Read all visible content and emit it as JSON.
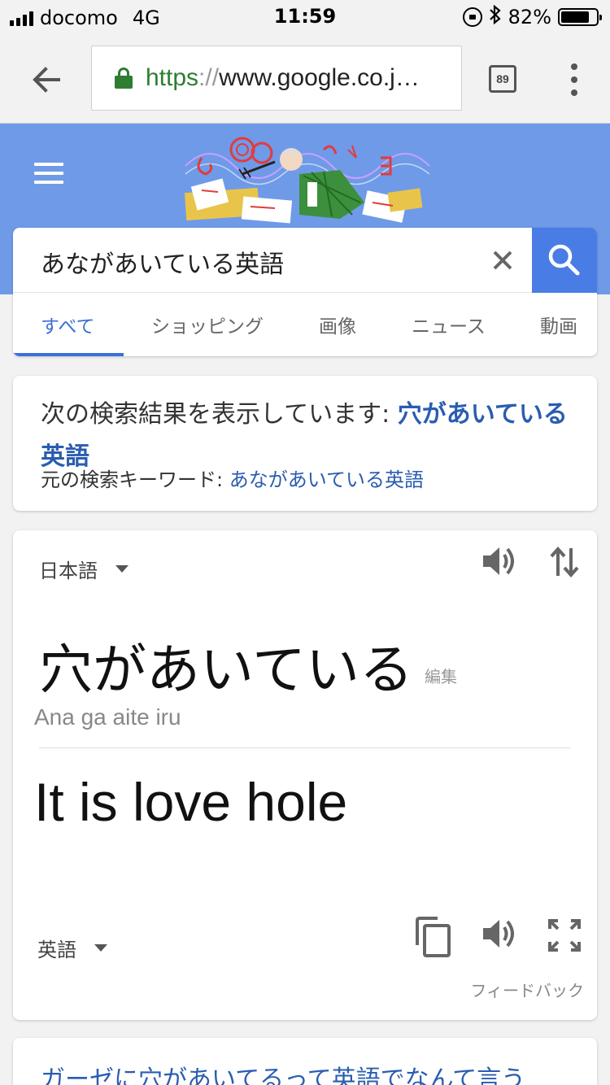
{
  "status_bar": {
    "carrier": "docomo",
    "network": "4G",
    "time": "11:59",
    "battery": "82%",
    "battery_level": 0.82
  },
  "browser": {
    "url_scheme": "https",
    "url_sep": "://",
    "url_host": "www.google.co.j…",
    "tab_count": "89"
  },
  "search": {
    "query": "あながあいている英語",
    "tabs": [
      "すべて",
      "ショッピング",
      "画像",
      "ニュース",
      "動画"
    ]
  },
  "suggestion": {
    "prefix": "次の検索結果を表示しています: ",
    "corrected": "穴があいている英語",
    "original_prefix": "元の検索キーワード: ",
    "original": "あながあいている英語"
  },
  "translate": {
    "source_lang": "日本語",
    "source_text": "穴があいている",
    "edit_label": "編集",
    "romanization": "Ana ga aite iru",
    "target_text": "It is love hole",
    "target_lang": "英語",
    "feedback_label": "フィードバック"
  },
  "next_result": {
    "title": "ガーゼに穴があいてるって英語でなんて言う"
  },
  "colors": {
    "header_blue": "#6f9ae8",
    "search_button": "#4a7ce6",
    "link": "#2a5db0",
    "secure_green": "#2e7d32"
  }
}
